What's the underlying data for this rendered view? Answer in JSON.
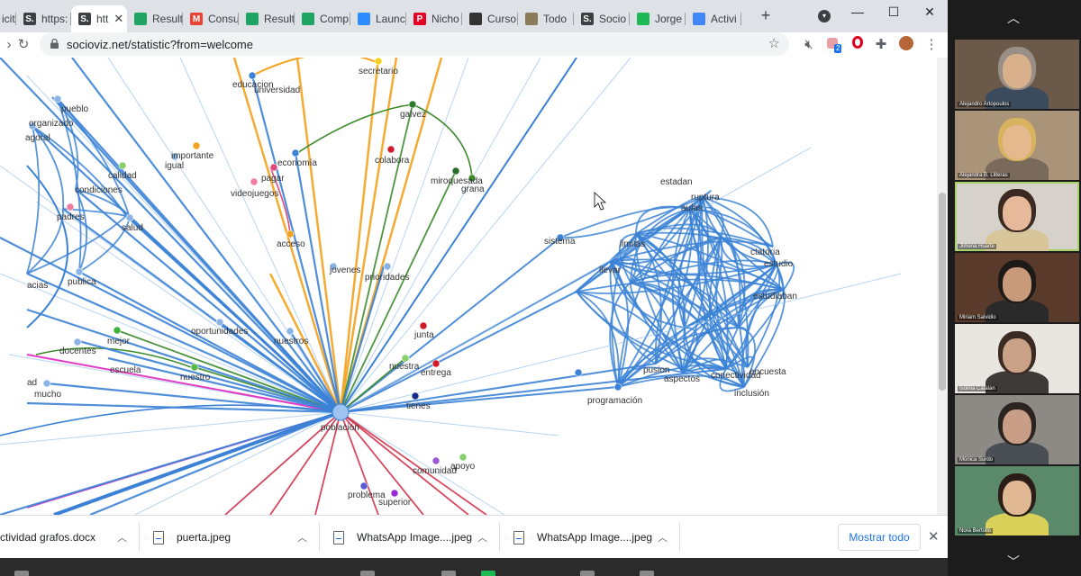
{
  "browser": {
    "tabs": [
      {
        "label": "icit",
        "fav": "",
        "fav_color": "#5f6368"
      },
      {
        "label": "https:",
        "fav": "S.",
        "fav_color": "#3c4043"
      },
      {
        "label": "htt",
        "fav": "S.",
        "fav_color": "#3c4043",
        "active": true
      },
      {
        "label": "Result",
        "fav": "",
        "fav_color": "#1fa463"
      },
      {
        "label": "Consu",
        "fav": "M",
        "fav_color": "#ea4335"
      },
      {
        "label": "Result",
        "fav": "",
        "fav_color": "#1fa463"
      },
      {
        "label": "Comp",
        "fav": "",
        "fav_color": "#1fa463"
      },
      {
        "label": "Launc",
        "fav": "",
        "fav_color": "#2d8cff"
      },
      {
        "label": "Nicho",
        "fav": "P",
        "fav_color": "#e60023"
      },
      {
        "label": "Curso",
        "fav": "",
        "fav_color": "#333333"
      },
      {
        "label": "Todo",
        "fav": "",
        "fav_color": "#8a7b5a"
      },
      {
        "label": "Socio",
        "fav": "S.",
        "fav_color": "#3c4043"
      },
      {
        "label": "Jorge",
        "fav": "",
        "fav_color": "#1db954"
      },
      {
        "label": "Activi",
        "fav": "",
        "fav_color": "#4285f4"
      }
    ],
    "url": "socioviz.net/statistic?from=welcome",
    "extension_badge": "2"
  },
  "graph": {
    "left_labels": [
      "pueblo",
      "organizado",
      "agoral",
      "calidad",
      "condiciones",
      "padres",
      "salud",
      "acias",
      "publica",
      "mejor",
      "docentes",
      "escuela",
      "ad",
      "mucho",
      "importante",
      "igual",
      "videojuegos",
      "pagar",
      "economía",
      "acceso",
      "educacion",
      "universidad",
      "secretario",
      "galvez",
      "colabora",
      "miroquesada",
      "grana",
      "jovenes",
      "prioridades",
      "oportunidades",
      "nuestros",
      "nuestro",
      "junta",
      "nuestra",
      "entrega",
      "tienes",
      "población",
      "comunidad",
      "apoyo",
      "problema",
      "superior"
    ],
    "right_labels": [
      "estadan",
      "ruptura",
      "aulas",
      "sistema",
      "limitas",
      "llevar",
      "ctatoria",
      "estudio",
      "estudiaban",
      "pusion",
      "aspectos",
      "conectividad",
      "encuesta",
      "inclusión",
      "programación"
    ]
  },
  "downloads": {
    "items": [
      "ctividad grafos.docx",
      "puerta.jpeg",
      "WhatsApp Image....jpeg",
      "WhatsApp Image....jpeg"
    ],
    "show_all": "Mostrar todo"
  },
  "zoom": {
    "participants": [
      {
        "name": "Alejandro Artopoulos",
        "bg": "#6b5a4a",
        "skin": "#d9b08c",
        "shirt": "#3b4a5c",
        "hair": "#9a8f86"
      },
      {
        "name": "Alejandra B. Lliteras",
        "bg": "#a9947a",
        "skin": "#e4b98e",
        "shirt": "#7a6a5b",
        "hair": "#d8b25e"
      },
      {
        "name": "Jimena Huarte",
        "bg": "#d6d2cb",
        "skin": "#e6b99a",
        "shirt": "#d8c69a",
        "hair": "#3a2a22",
        "active": true
      },
      {
        "name": "Miriam Salvidio",
        "bg": "#5a3a2a",
        "skin": "#c99a7a",
        "shirt": "#2a2a2a",
        "hair": "#1e1a18"
      },
      {
        "name": "Isolina Catalan",
        "bg": "#e9e6e1",
        "skin": "#caa287",
        "shirt": "#3e3a37",
        "hair": "#3b2b22"
      },
      {
        "name": "Mónica Surdo",
        "bg": "#8d8a86",
        "skin": "#c89f86",
        "shirt": "#4a4f55",
        "hair": "#2b2420"
      },
      {
        "name": "Nora Bertollo",
        "bg": "#5a8a6a",
        "skin": "#e0b894",
        "shirt": "#d9d05a",
        "hair": "#2b1e18"
      }
    ]
  }
}
